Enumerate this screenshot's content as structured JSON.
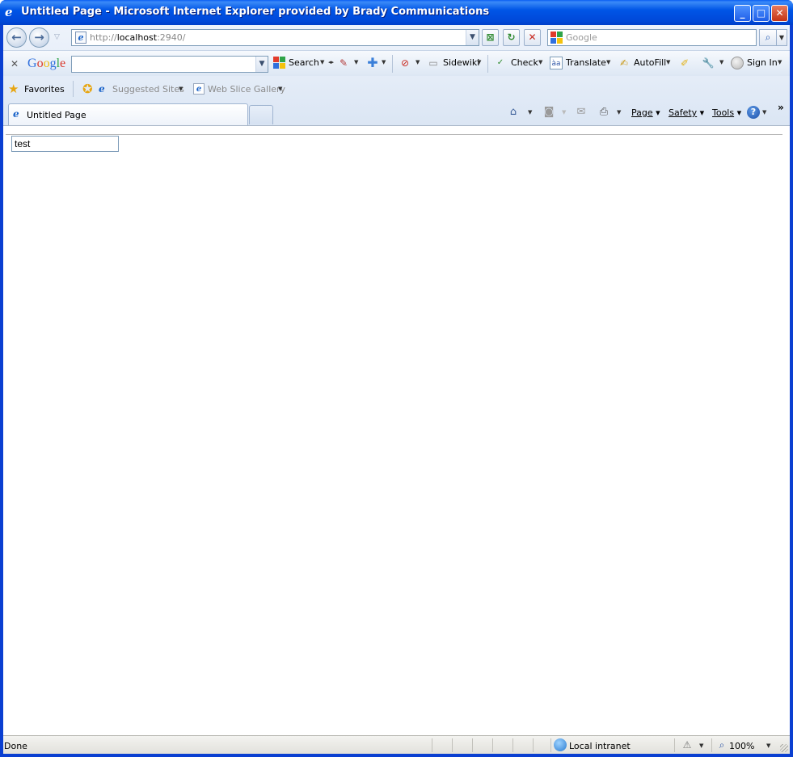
{
  "window": {
    "title": "Untitled Page - Microsoft Internet Explorer provided by Brady Communications",
    "controls": {
      "minimize": "_",
      "maximize": "□",
      "close": "✕"
    }
  },
  "address_bar": {
    "url_prefix": "http://",
    "url_host": "localhost",
    "url_suffix": ":2940/"
  },
  "search_box": {
    "placeholder": "Google"
  },
  "google_toolbar": {
    "logo": "Google",
    "search_label": "Search",
    "sidewiki_label": "Sidewiki",
    "check_label": "Check",
    "translate_label": "Translate",
    "autofill_label": "AutoFill",
    "signin_label": "Sign In"
  },
  "favorites_bar": {
    "favorites_label": "Favorites",
    "links": [
      "Suggested Sites",
      "Web Slice Gallery"
    ]
  },
  "tabs": [
    {
      "label": "Untitled Page",
      "active": true
    }
  ],
  "command_bar": {
    "page_label": "Page",
    "safety_label": "Safety",
    "tools_label": "Tools"
  },
  "page": {
    "input_value": "test"
  },
  "status_bar": {
    "status": "Done",
    "zone": "Local intranet",
    "zoom": "100%"
  },
  "colors": {
    "titlebar": "#0055e6",
    "chrome": "#dbe6f4",
    "statusbar": "#e2e1dc"
  }
}
